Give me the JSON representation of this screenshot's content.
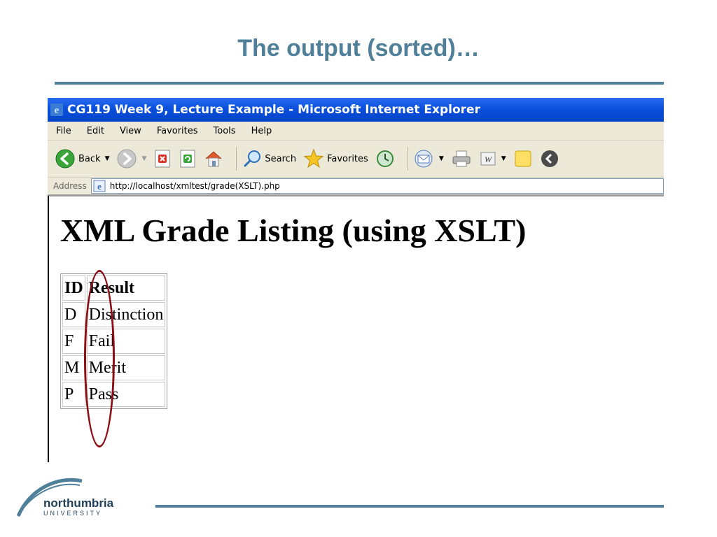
{
  "slide": {
    "title": "The output (sorted)…"
  },
  "window": {
    "title": "CG119 Week 9, Lecture Example - Microsoft Internet Explorer"
  },
  "menu": [
    "File",
    "Edit",
    "View",
    "Favorites",
    "Tools",
    "Help"
  ],
  "toolbar": {
    "back_label": "Back",
    "search_label": "Search",
    "favorites_label": "Favorites"
  },
  "address": {
    "label": "Address",
    "url": "http://localhost/xmltest/grade(XSLT).php"
  },
  "page": {
    "heading": "XML Grade Listing (using XSLT)",
    "table": {
      "headers": [
        "ID",
        "Result"
      ],
      "rows": [
        [
          "D",
          "Distinction"
        ],
        [
          "F",
          "Fail"
        ],
        [
          "M",
          "Merit"
        ],
        [
          "P",
          "Pass"
        ]
      ]
    }
  },
  "footer": {
    "logo_word": "northumbria",
    "logo_sub": "UNIVERSITY"
  },
  "colors": {
    "accent": "#4f7f99",
    "titlebar": "#0a4fdc",
    "highlight": "#8b0f14"
  }
}
